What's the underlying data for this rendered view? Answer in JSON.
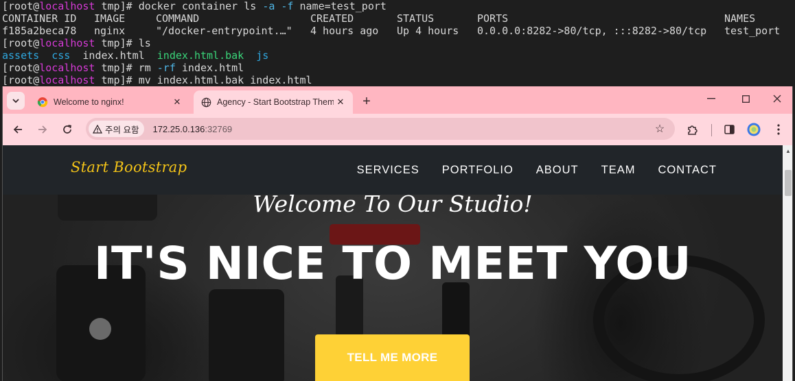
{
  "terminal": {
    "prompt_open": "[root@",
    "host": "localhost",
    "prompt_close": " tmp]# ",
    "cmd1_a": "docker container ls ",
    "cmd1_opt1": "-a",
    "cmd1_b": " ",
    "cmd1_opt2": "-f",
    "cmd1_c": " name=test_port",
    "table_headers": [
      "CONTAINER ID",
      "IMAGE",
      "COMMAND",
      "CREATED",
      "STATUS",
      "PORTS",
      "NAMES"
    ],
    "table_row": [
      "f185a2beca78",
      "nginx",
      "\"/docker-entrypoint.…\"",
      "4 hours ago",
      "Up 4 hours",
      "0.0.0.0:8282->80/tcp, :::8282->80/tcp",
      "test_port"
    ],
    "cmd2": "ls",
    "ls_items": [
      "assets",
      "css",
      "index.html",
      "index.html.bak",
      "js"
    ],
    "cmd3_a": "rm ",
    "cmd3_opt": "-rf",
    "cmd3_b": " index.html",
    "cmd4": "mv index.html.bak index.html"
  },
  "browser": {
    "tabs": [
      {
        "title": "Welcome to nginx!",
        "active": false
      },
      {
        "title": "Agency - Start Bootstrap Theme",
        "active": true
      }
    ],
    "security_chip": "주의 요함",
    "url_host": "172.25.0.136",
    "url_port": ":32769"
  },
  "page": {
    "brand": "Start Bootstrap",
    "nav": [
      "SERVICES",
      "PORTFOLIO",
      "ABOUT",
      "TEAM",
      "CONTACT"
    ],
    "subheading": "Welcome To Our Studio!",
    "heading": "IT'S NICE TO MEET YOU",
    "cta": "TELL ME MORE"
  },
  "colors": {
    "browser_frame": "#ffb6c1",
    "navbar": "#212529",
    "brand": "#f5c518",
    "cta": "#fed136"
  }
}
